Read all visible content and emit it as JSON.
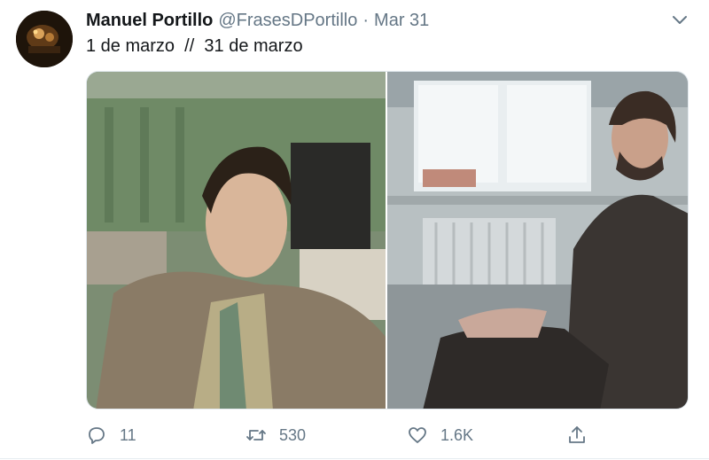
{
  "tweet": {
    "author_name": "Manuel Portillo",
    "author_handle": "@FrasesDPortillo",
    "separator": "·",
    "timestamp": "Mar 31",
    "text": "1 de marzo  //  31 de marzo",
    "media": [
      {
        "id": "left",
        "description": "photo of young man in suit and striped tie"
      },
      {
        "id": "right",
        "description": "photo of bearded disheveled man sitting by window"
      }
    ],
    "actions": {
      "replies": "11",
      "retweets": "530",
      "likes": "1.6K"
    }
  },
  "icons": {
    "reply": "reply-icon",
    "retweet": "retweet-icon",
    "like": "heart-icon",
    "share": "share-icon",
    "menu": "chevron-down-icon"
  },
  "colors": {
    "name": "#14171a",
    "secondary": "#657786",
    "border": "#e1e8ed"
  }
}
